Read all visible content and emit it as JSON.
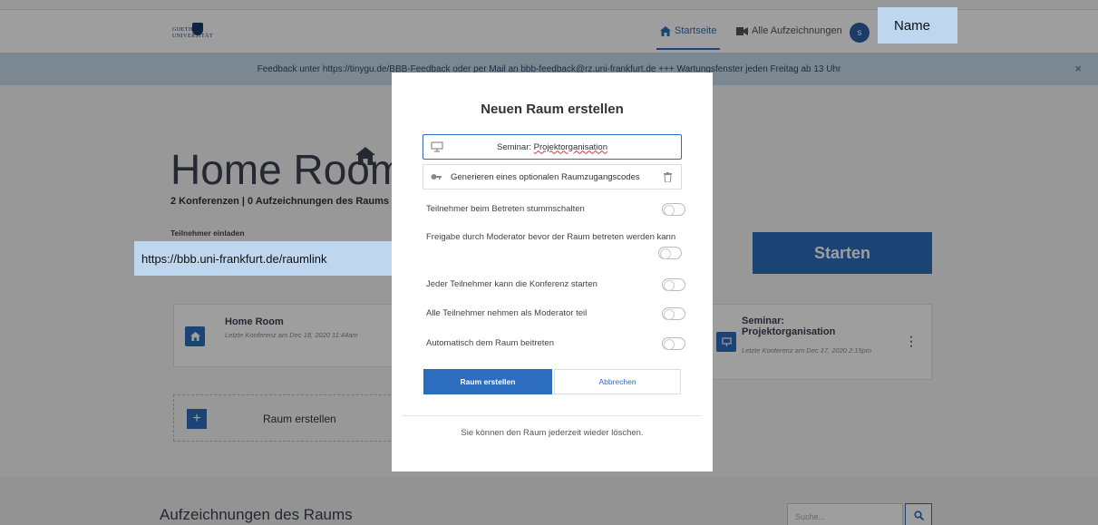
{
  "colors": {
    "accent": "#2d6dbf",
    "callout": "#bfd7ee",
    "banner": "#c8dbeb"
  },
  "navbar": {
    "logo_line1": "GOETHE",
    "logo_line2": "UNIVERSITÄT",
    "home_label": "Startseite",
    "recordings_label": "Alle Aufzeichnungen",
    "avatar_initial": "s",
    "name_callout": "Name"
  },
  "banner": {
    "text": "Feedback unter https://tinygu.de/BBB-Feedback oder per Mail an bbb-feedback@rz.uni-frankfurt.de +++ Wartungsfenster jeden Freitag ab 13 Uhr",
    "close": "×"
  },
  "room": {
    "title": "Home Room",
    "counts": "2 Konferenzen | 0 Aufzeichnungen des Raums",
    "invite_label": "Teilnehmer einladen",
    "url_callout": "https://bbb.uni-frankfurt.de/raumlink",
    "start_label": "Starten"
  },
  "cards": [
    {
      "title": "Home Room",
      "sub": "Letzte Konferenz am Dec 18, 2020 11:44am"
    },
    {
      "title": "Seminar: Projektorganisation",
      "sub": "Letzte Konferenz am Dec 17, 2020 2:15pm"
    }
  ],
  "create_card": {
    "plus": "+",
    "label": "Raum erstellen"
  },
  "recordings": {
    "heading": "Aufzeichnungen des Raums",
    "search_placeholder": "Suche..."
  },
  "modal": {
    "title": "Neuen Raum erstellen",
    "name_prefix": "Seminar: ",
    "name_value": "Projektorganisation",
    "access_code_label": "Generieren eines optionalen Raumzugangscodes",
    "toggles": [
      {
        "label": "Teilnehmer beim Betreten stummschalten",
        "on": false
      },
      {
        "label": "Freigabe durch Moderator bevor der Raum betreten werden kann",
        "on": false
      },
      {
        "label": "Jeder Teilnehmer kann die Konferenz starten",
        "on": false
      },
      {
        "label": "Alle Teilnehmer nehmen als Moderator teil",
        "on": false
      },
      {
        "label": "Automatisch dem Raum beitreten",
        "on": false
      }
    ],
    "create_label": "Raum erstellen",
    "cancel_label": "Abbrechen",
    "footer": "Sie können den Raum jederzeit wieder löschen."
  }
}
